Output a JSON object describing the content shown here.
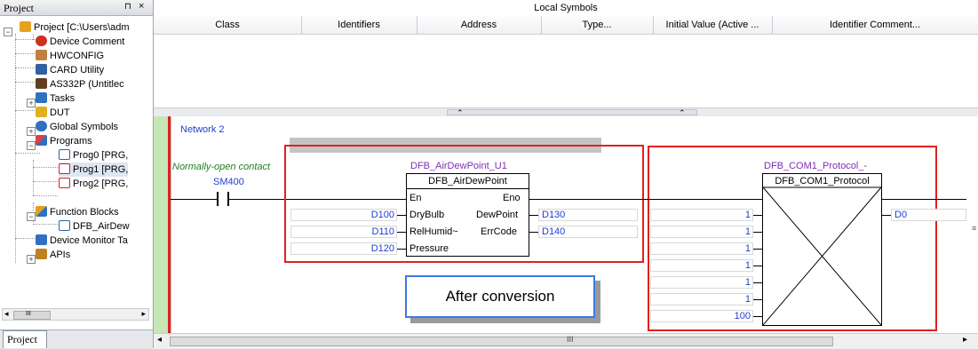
{
  "project_panel": {
    "title": "Project",
    "pin": "⊓",
    "close": "×",
    "tab": "Project",
    "scroll_mid": "III",
    "items": [
      {
        "label": "Project [C:\\Users\\adm",
        "icon": "project-icon",
        "color": "#e8a020"
      },
      {
        "label": "Device Comment",
        "icon": "device-comment-icon",
        "color": "#d03020"
      },
      {
        "label": "HWCONFIG",
        "icon": "hwconfig-icon",
        "color": "#c08040"
      },
      {
        "label": "CARD Utility",
        "icon": "card-utility-icon",
        "color": "#3060a0"
      },
      {
        "label": "AS332P  (Untitlec",
        "icon": "plc-icon",
        "color": "#604020"
      },
      {
        "label": "Tasks",
        "icon": "tasks-icon",
        "color": "#3070c0"
      },
      {
        "label": "DUT",
        "icon": "dut-icon",
        "color": "#e0b020"
      },
      {
        "label": "Global Symbols",
        "icon": "global-symbols-icon",
        "color": "#3070c0"
      },
      {
        "label": "Programs",
        "icon": "programs-icon",
        "color": "#e04040"
      },
      {
        "label": "Prog0 [PRG,",
        "icon": "prog-icon",
        "color": "#3060a0"
      },
      {
        "label": "Prog1 [PRG,",
        "icon": "prog-error-icon",
        "color": "#d02020"
      },
      {
        "label": "Prog2 [PRG,",
        "icon": "prog-error-icon",
        "color": "#d02020"
      },
      {
        "label": "Function Blocks",
        "icon": "function-blocks-icon",
        "color": "#e0a020"
      },
      {
        "label": "DFB_AirDew",
        "icon": "fb-icon",
        "color": "#3060a0"
      },
      {
        "label": "Device Monitor Ta",
        "icon": "device-monitor-icon",
        "color": "#3070c0"
      },
      {
        "label": "APIs",
        "icon": "apis-icon",
        "color": "#c08020"
      }
    ]
  },
  "local_symbols": {
    "title": "Local Symbols",
    "columns": [
      "Class",
      "Identifiers",
      "Address",
      "Type...",
      "Initial Value (Active ...",
      "Identifier Comment..."
    ]
  },
  "editor": {
    "network_label": "Network 2",
    "contact_comment": "Normally-open contact",
    "contact_address": "SM400",
    "fb1": {
      "instance": "DFB_AirDewPoint_U1",
      "type": "DFB_AirDewPoint",
      "in_pins": [
        "En",
        "DryBulb",
        "RelHumid~",
        "Pressure"
      ],
      "out_pins": [
        "Eno",
        "DewPoint",
        "ErrCode"
      ],
      "in_values": [
        "D100",
        "D110",
        "D120"
      ],
      "out_values": [
        "D130",
        "D140"
      ]
    },
    "fb2": {
      "instance": "DFB_COM1_Protocol_-",
      "type": "DFB_COM1_Protocol",
      "in_values": [
        "1",
        "1",
        "1",
        "1",
        "1",
        "1",
        "100"
      ],
      "out_value": "D0"
    },
    "callout": "After conversion",
    "scroll_mid": "III"
  }
}
